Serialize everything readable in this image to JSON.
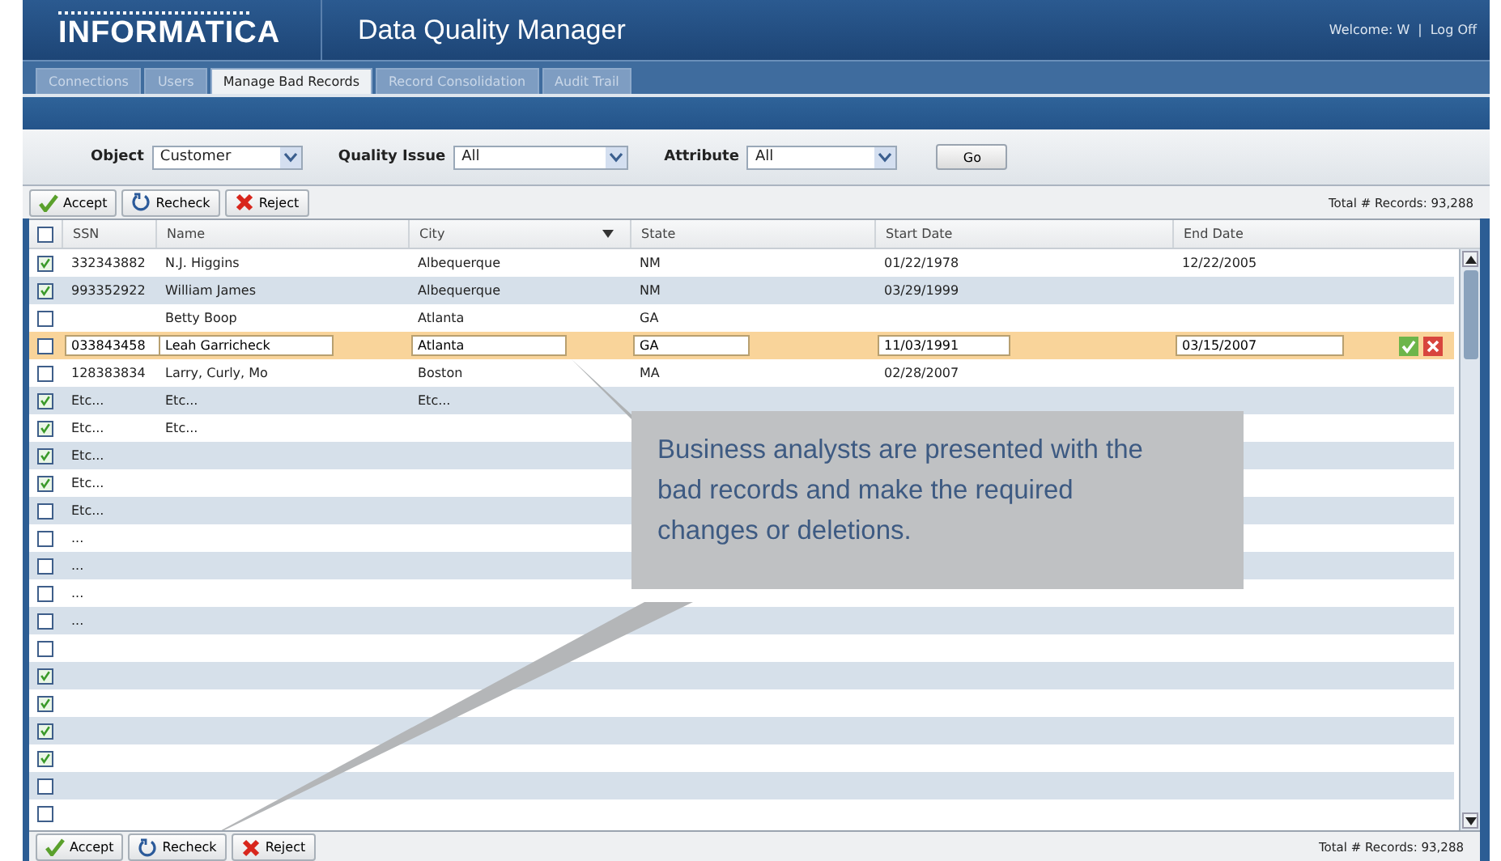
{
  "header": {
    "logo": "INFORMATICA",
    "title": "Data Quality Manager",
    "welcome": "Welcome: W",
    "separator": "|",
    "logout": "Log Off"
  },
  "tabs": [
    {
      "label": "Connections",
      "selected": false
    },
    {
      "label": "Users",
      "selected": false
    },
    {
      "label": "Manage Bad Records",
      "selected": true
    },
    {
      "label": "Record Consolidation",
      "selected": false
    },
    {
      "label": "Audit Trail",
      "selected": false
    }
  ],
  "filters": [
    {
      "label": "Object",
      "value": "Customer"
    },
    {
      "label": "Quality Issue",
      "value": "All"
    },
    {
      "label": "Attribute",
      "value": "All"
    }
  ],
  "go_button": "Go",
  "toolbar": {
    "buttons": [
      {
        "kind": "accept",
        "label": "Accept"
      },
      {
        "kind": "recheck",
        "label": "Recheck"
      },
      {
        "kind": "reject",
        "label": "Reject"
      }
    ],
    "total": "Total # Records: 93,288"
  },
  "table": {
    "header_checked": false,
    "columns": [
      {
        "label": "SSN",
        "sortable": false
      },
      {
        "label": "Name",
        "sortable": false
      },
      {
        "label": "City",
        "sortable": true
      },
      {
        "label": "State",
        "sortable": false
      },
      {
        "label": "Start Date",
        "sortable": false
      },
      {
        "label": "End Date",
        "sortable": false
      }
    ],
    "rows": [
      {
        "checked": true,
        "editing": false,
        "cells": [
          "332343882",
          "N.J. Higgins",
          "Albequerque",
          "NM",
          "01/22/1978",
          "12/22/2005"
        ]
      },
      {
        "checked": true,
        "editing": false,
        "cells": [
          "993352922",
          "William James",
          "Albequerque",
          "NM",
          "03/29/1999",
          ""
        ]
      },
      {
        "checked": false,
        "editing": false,
        "cells": [
          "",
          "Betty Boop",
          "Atlanta",
          "GA",
          "",
          ""
        ]
      },
      {
        "checked": false,
        "editing": true,
        "cells": [
          "033843458",
          "Leah Garricheck",
          "Atlanta",
          "GA",
          "11/03/1991",
          "03/15/2007"
        ]
      },
      {
        "checked": false,
        "editing": false,
        "cells": [
          "128383834",
          "Larry, Curly, Mo",
          "Boston",
          "MA",
          "02/28/2007",
          ""
        ]
      },
      {
        "checked": true,
        "editing": false,
        "cells": [
          "Etc...",
          "Etc...",
          "Etc...",
          "",
          "",
          ""
        ]
      },
      {
        "checked": true,
        "editing": false,
        "cells": [
          "Etc...",
          "Etc...",
          "",
          "",
          "",
          ""
        ]
      },
      {
        "checked": true,
        "editing": false,
        "cells": [
          "Etc...",
          "",
          "",
          "",
          "",
          ""
        ]
      },
      {
        "checked": true,
        "editing": false,
        "cells": [
          "Etc...",
          "",
          "",
          "",
          "",
          ""
        ]
      },
      {
        "checked": false,
        "editing": false,
        "cells": [
          "Etc...",
          "",
          "",
          "",
          "",
          ""
        ]
      },
      {
        "checked": false,
        "editing": false,
        "cells": [
          "...",
          "",
          "",
          "",
          "",
          ""
        ]
      },
      {
        "checked": false,
        "editing": false,
        "cells": [
          "...",
          "",
          "",
          "",
          "",
          ""
        ]
      },
      {
        "checked": false,
        "editing": false,
        "cells": [
          "...",
          "",
          "",
          "",
          "",
          ""
        ]
      },
      {
        "checked": false,
        "editing": false,
        "cells": [
          "...",
          "",
          "",
          "",
          "",
          ""
        ]
      },
      {
        "checked": false,
        "editing": false,
        "cells": [
          "",
          "",
          "",
          "",
          "",
          ""
        ]
      },
      {
        "checked": true,
        "editing": false,
        "cells": [
          "",
          "",
          "",
          "",
          "",
          ""
        ]
      },
      {
        "checked": true,
        "editing": false,
        "cells": [
          "",
          "",
          "",
          "",
          "",
          ""
        ]
      },
      {
        "checked": true,
        "editing": false,
        "cells": [
          "",
          "",
          "",
          "",
          "",
          ""
        ]
      },
      {
        "checked": true,
        "editing": false,
        "cells": [
          "",
          "",
          "",
          "",
          "",
          ""
        ]
      },
      {
        "checked": false,
        "editing": false,
        "cells": [
          "",
          "",
          "",
          "",
          "",
          ""
        ]
      },
      {
        "checked": false,
        "editing": false,
        "cells": [
          "",
          "",
          "",
          "",
          "",
          ""
        ]
      }
    ]
  },
  "bottom_toolbar": {
    "buttons": [
      {
        "kind": "accept",
        "label": "Accept"
      },
      {
        "kind": "recheck",
        "label": "Recheck"
      },
      {
        "kind": "reject",
        "label": "Reject"
      }
    ],
    "total": "Total # Records: 93,288"
  },
  "callout": {
    "text": "Business analysts are presented with the bad records and make the required changes or deletions."
  }
}
